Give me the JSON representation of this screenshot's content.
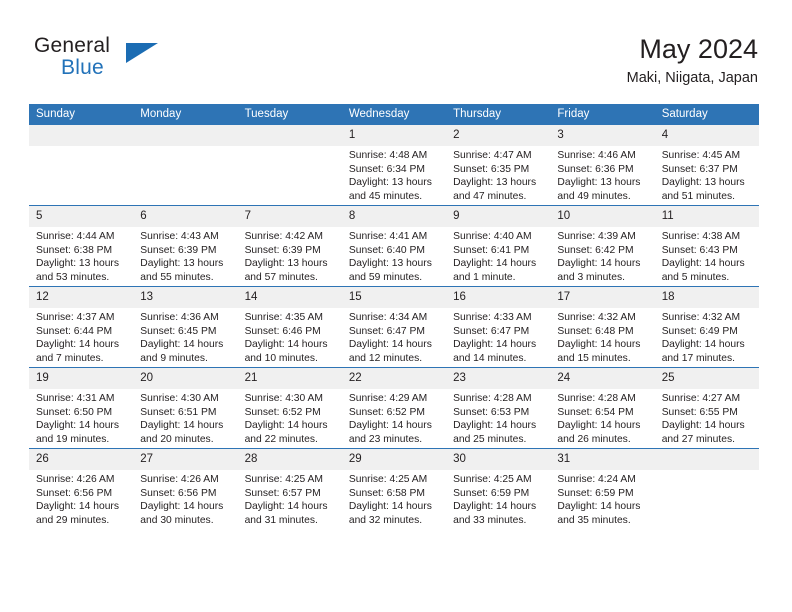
{
  "brand": {
    "word1": "General",
    "word2": "Blue",
    "triangle_color": "#1b6cb3"
  },
  "header": {
    "title": "May 2024",
    "subtitle": "Maki, Niigata, Japan",
    "accent_color": "#2e74b5",
    "daynum_band_color": "#f0f0f0"
  },
  "weekday_headers": [
    "Sunday",
    "Monday",
    "Tuesday",
    "Wednesday",
    "Thursday",
    "Friday",
    "Saturday"
  ],
  "labels": {
    "sunrise": "Sunrise:",
    "sunset": "Sunset:",
    "daylight": "Daylight:"
  },
  "weeks": [
    [
      {
        "day": "",
        "sunrise": "",
        "sunset": "",
        "daylight_line1": "",
        "daylight_line2": ""
      },
      {
        "day": "",
        "sunrise": "",
        "sunset": "",
        "daylight_line1": "",
        "daylight_line2": ""
      },
      {
        "day": "",
        "sunrise": "",
        "sunset": "",
        "daylight_line1": "",
        "daylight_line2": ""
      },
      {
        "day": "1",
        "sunrise": "Sunrise: 4:48 AM",
        "sunset": "Sunset: 6:34 PM",
        "daylight_line1": "Daylight: 13 hours",
        "daylight_line2": "and 45 minutes."
      },
      {
        "day": "2",
        "sunrise": "Sunrise: 4:47 AM",
        "sunset": "Sunset: 6:35 PM",
        "daylight_line1": "Daylight: 13 hours",
        "daylight_line2": "and 47 minutes."
      },
      {
        "day": "3",
        "sunrise": "Sunrise: 4:46 AM",
        "sunset": "Sunset: 6:36 PM",
        "daylight_line1": "Daylight: 13 hours",
        "daylight_line2": "and 49 minutes."
      },
      {
        "day": "4",
        "sunrise": "Sunrise: 4:45 AM",
        "sunset": "Sunset: 6:37 PM",
        "daylight_line1": "Daylight: 13 hours",
        "daylight_line2": "and 51 minutes."
      }
    ],
    [
      {
        "day": "5",
        "sunrise": "Sunrise: 4:44 AM",
        "sunset": "Sunset: 6:38 PM",
        "daylight_line1": "Daylight: 13 hours",
        "daylight_line2": "and 53 minutes."
      },
      {
        "day": "6",
        "sunrise": "Sunrise: 4:43 AM",
        "sunset": "Sunset: 6:39 PM",
        "daylight_line1": "Daylight: 13 hours",
        "daylight_line2": "and 55 minutes."
      },
      {
        "day": "7",
        "sunrise": "Sunrise: 4:42 AM",
        "sunset": "Sunset: 6:39 PM",
        "daylight_line1": "Daylight: 13 hours",
        "daylight_line2": "and 57 minutes."
      },
      {
        "day": "8",
        "sunrise": "Sunrise: 4:41 AM",
        "sunset": "Sunset: 6:40 PM",
        "daylight_line1": "Daylight: 13 hours",
        "daylight_line2": "and 59 minutes."
      },
      {
        "day": "9",
        "sunrise": "Sunrise: 4:40 AM",
        "sunset": "Sunset: 6:41 PM",
        "daylight_line1": "Daylight: 14 hours",
        "daylight_line2": "and 1 minute."
      },
      {
        "day": "10",
        "sunrise": "Sunrise: 4:39 AM",
        "sunset": "Sunset: 6:42 PM",
        "daylight_line1": "Daylight: 14 hours",
        "daylight_line2": "and 3 minutes."
      },
      {
        "day": "11",
        "sunrise": "Sunrise: 4:38 AM",
        "sunset": "Sunset: 6:43 PM",
        "daylight_line1": "Daylight: 14 hours",
        "daylight_line2": "and 5 minutes."
      }
    ],
    [
      {
        "day": "12",
        "sunrise": "Sunrise: 4:37 AM",
        "sunset": "Sunset: 6:44 PM",
        "daylight_line1": "Daylight: 14 hours",
        "daylight_line2": "and 7 minutes."
      },
      {
        "day": "13",
        "sunrise": "Sunrise: 4:36 AM",
        "sunset": "Sunset: 6:45 PM",
        "daylight_line1": "Daylight: 14 hours",
        "daylight_line2": "and 9 minutes."
      },
      {
        "day": "14",
        "sunrise": "Sunrise: 4:35 AM",
        "sunset": "Sunset: 6:46 PM",
        "daylight_line1": "Daylight: 14 hours",
        "daylight_line2": "and 10 minutes."
      },
      {
        "day": "15",
        "sunrise": "Sunrise: 4:34 AM",
        "sunset": "Sunset: 6:47 PM",
        "daylight_line1": "Daylight: 14 hours",
        "daylight_line2": "and 12 minutes."
      },
      {
        "day": "16",
        "sunrise": "Sunrise: 4:33 AM",
        "sunset": "Sunset: 6:47 PM",
        "daylight_line1": "Daylight: 14 hours",
        "daylight_line2": "and 14 minutes."
      },
      {
        "day": "17",
        "sunrise": "Sunrise: 4:32 AM",
        "sunset": "Sunset: 6:48 PM",
        "daylight_line1": "Daylight: 14 hours",
        "daylight_line2": "and 15 minutes."
      },
      {
        "day": "18",
        "sunrise": "Sunrise: 4:32 AM",
        "sunset": "Sunset: 6:49 PM",
        "daylight_line1": "Daylight: 14 hours",
        "daylight_line2": "and 17 minutes."
      }
    ],
    [
      {
        "day": "19",
        "sunrise": "Sunrise: 4:31 AM",
        "sunset": "Sunset: 6:50 PM",
        "daylight_line1": "Daylight: 14 hours",
        "daylight_line2": "and 19 minutes."
      },
      {
        "day": "20",
        "sunrise": "Sunrise: 4:30 AM",
        "sunset": "Sunset: 6:51 PM",
        "daylight_line1": "Daylight: 14 hours",
        "daylight_line2": "and 20 minutes."
      },
      {
        "day": "21",
        "sunrise": "Sunrise: 4:30 AM",
        "sunset": "Sunset: 6:52 PM",
        "daylight_line1": "Daylight: 14 hours",
        "daylight_line2": "and 22 minutes."
      },
      {
        "day": "22",
        "sunrise": "Sunrise: 4:29 AM",
        "sunset": "Sunset: 6:52 PM",
        "daylight_line1": "Daylight: 14 hours",
        "daylight_line2": "and 23 minutes."
      },
      {
        "day": "23",
        "sunrise": "Sunrise: 4:28 AM",
        "sunset": "Sunset: 6:53 PM",
        "daylight_line1": "Daylight: 14 hours",
        "daylight_line2": "and 25 minutes."
      },
      {
        "day": "24",
        "sunrise": "Sunrise: 4:28 AM",
        "sunset": "Sunset: 6:54 PM",
        "daylight_line1": "Daylight: 14 hours",
        "daylight_line2": "and 26 minutes."
      },
      {
        "day": "25",
        "sunrise": "Sunrise: 4:27 AM",
        "sunset": "Sunset: 6:55 PM",
        "daylight_line1": "Daylight: 14 hours",
        "daylight_line2": "and 27 minutes."
      }
    ],
    [
      {
        "day": "26",
        "sunrise": "Sunrise: 4:26 AM",
        "sunset": "Sunset: 6:56 PM",
        "daylight_line1": "Daylight: 14 hours",
        "daylight_line2": "and 29 minutes."
      },
      {
        "day": "27",
        "sunrise": "Sunrise: 4:26 AM",
        "sunset": "Sunset: 6:56 PM",
        "daylight_line1": "Daylight: 14 hours",
        "daylight_line2": "and 30 minutes."
      },
      {
        "day": "28",
        "sunrise": "Sunrise: 4:25 AM",
        "sunset": "Sunset: 6:57 PM",
        "daylight_line1": "Daylight: 14 hours",
        "daylight_line2": "and 31 minutes."
      },
      {
        "day": "29",
        "sunrise": "Sunrise: 4:25 AM",
        "sunset": "Sunset: 6:58 PM",
        "daylight_line1": "Daylight: 14 hours",
        "daylight_line2": "and 32 minutes."
      },
      {
        "day": "30",
        "sunrise": "Sunrise: 4:25 AM",
        "sunset": "Sunset: 6:59 PM",
        "daylight_line1": "Daylight: 14 hours",
        "daylight_line2": "and 33 minutes."
      },
      {
        "day": "31",
        "sunrise": "Sunrise: 4:24 AM",
        "sunset": "Sunset: 6:59 PM",
        "daylight_line1": "Daylight: 14 hours",
        "daylight_line2": "and 35 minutes."
      },
      {
        "day": "",
        "sunrise": "",
        "sunset": "",
        "daylight_line1": "",
        "daylight_line2": ""
      }
    ]
  ]
}
